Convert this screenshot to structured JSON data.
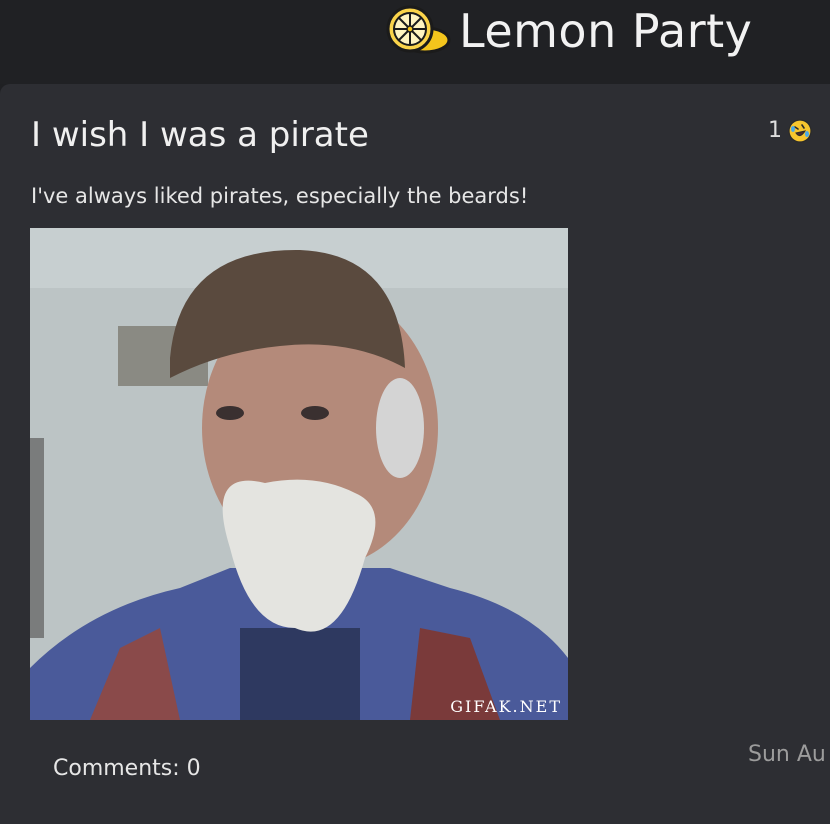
{
  "header": {
    "title": "Lemon Party",
    "logo_icon": "lemon-slice-icon"
  },
  "post": {
    "title": "I wish I was a pirate",
    "body": "I've always liked pirates, especially the beards!",
    "reaction_count": "1",
    "reaction_icon": "rolling-on-floor-laughing-emoji-icon",
    "image_watermark": "GIFAK.NET",
    "comments_label": "Comments: 0",
    "date": "Sun Au"
  },
  "colors": {
    "topbar_bg": "#202124",
    "card_bg": "#2d2e33",
    "lemon_yellow": "#f4c51c"
  }
}
